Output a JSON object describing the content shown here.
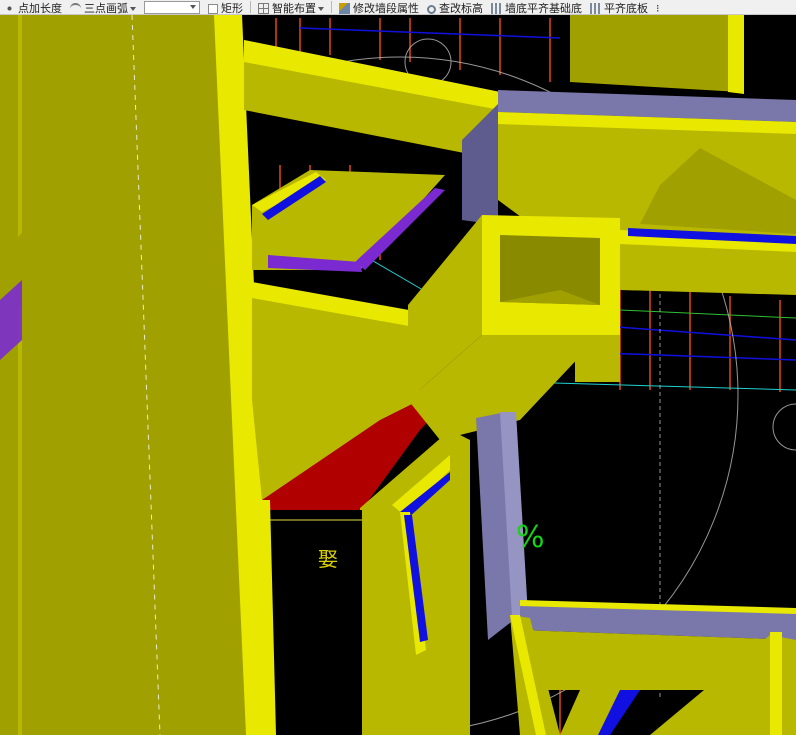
{
  "toolbar": {
    "items": [
      {
        "label": "点加长度"
      },
      {
        "label": "三点画弧"
      },
      {
        "label": "矩形"
      },
      {
        "label": "智能布置"
      },
      {
        "label": "修改墙段属性"
      },
      {
        "label": "查改标高"
      },
      {
        "label": "墙底平齐基础底"
      },
      {
        "label": "平齐底板"
      }
    ],
    "combo_value": ""
  },
  "viewport": {
    "percent_label": "%",
    "chinese_label": "娶",
    "colors": {
      "background": "#000000",
      "beam_yellow": "#b8b800",
      "beam_bright": "#e8e800",
      "wall_lavender": "#7a78aa",
      "opening_red": "#b00000",
      "rebar_blue": "#1010e0",
      "rebar_purple": "#7a2ad0",
      "grid_red": "#e04a10"
    }
  }
}
